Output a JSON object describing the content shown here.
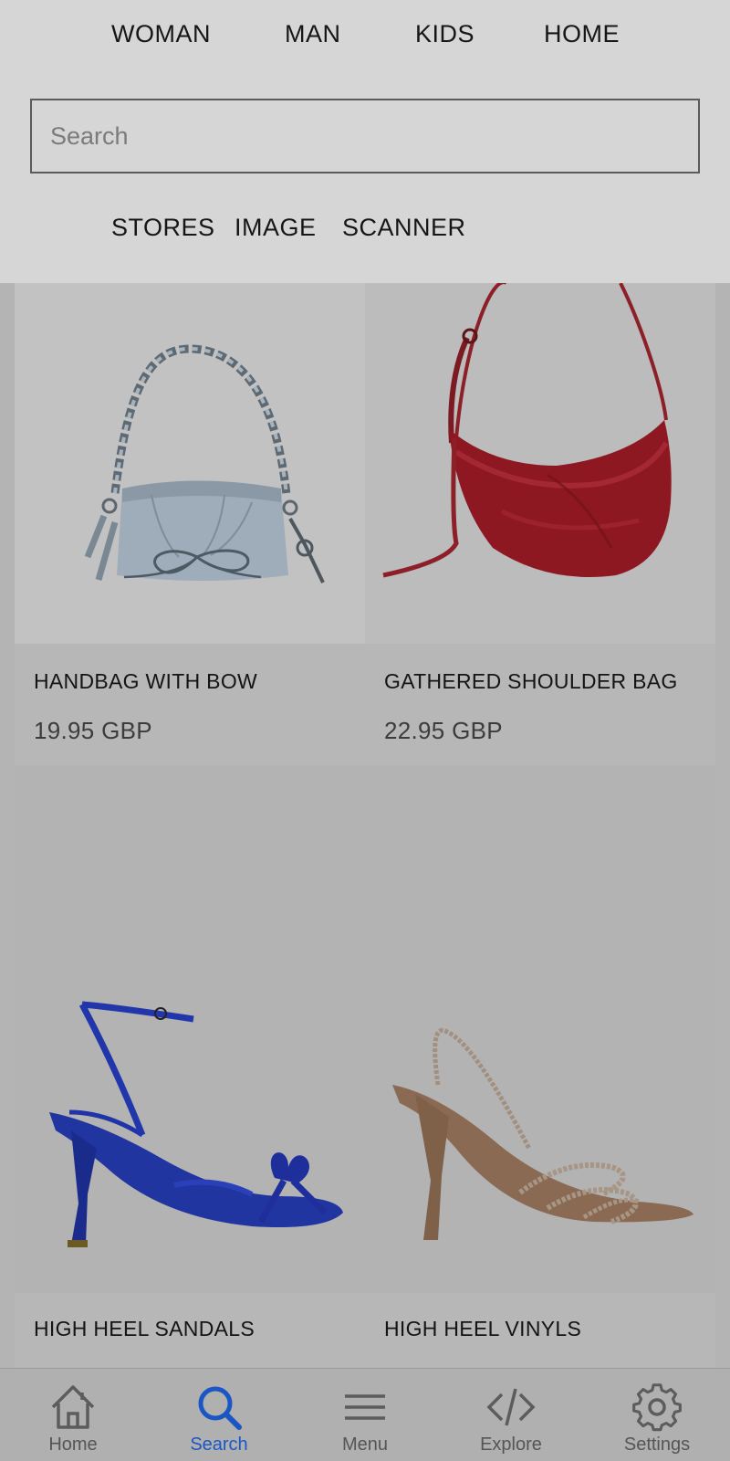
{
  "top_nav": [
    "WOMAN",
    "MAN",
    "KIDS",
    "HOME"
  ],
  "search": {
    "placeholder": "Search"
  },
  "sub_nav": [
    "STORES",
    "IMAGE",
    "SCANNER"
  ],
  "products": [
    {
      "name": "HANDBAG WITH BOW",
      "price": "19.95 GBP"
    },
    {
      "name": "GATHERED SHOULDER BAG",
      "price": "22.95 GBP"
    },
    {
      "name": "HIGH HEEL SANDALS"
    },
    {
      "name": "HIGH HEEL VINYLS"
    }
  ],
  "bottom_nav": [
    {
      "label": "Home",
      "icon": "home-icon",
      "active": false
    },
    {
      "label": "Search",
      "icon": "search-icon",
      "active": true
    },
    {
      "label": "Menu",
      "icon": "menu-icon",
      "active": false
    },
    {
      "label": "Explore",
      "icon": "code-icon",
      "active": false
    },
    {
      "label": "Settings",
      "icon": "gear-icon",
      "active": false
    }
  ],
  "colors": {
    "accent": "#1a56c4",
    "header_bg": "#d6d6d6",
    "page_bg": "#b4b4b4"
  }
}
